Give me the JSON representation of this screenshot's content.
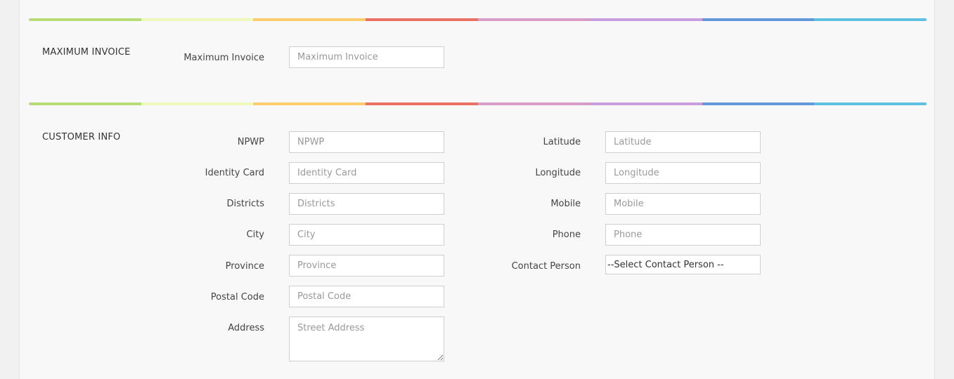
{
  "stripe_colors": [
    "#b5dc77",
    "#eef8b9",
    "#fdcd6d",
    "#ea7264",
    "#d79cc8",
    "#c89ede",
    "#6398dc",
    "#5fc1de"
  ],
  "max_invoice": {
    "title": "MAXIMUM INVOICE",
    "label": "Maximum Invoice",
    "placeholder": "Maximum Invoice",
    "value": ""
  },
  "customer_info": {
    "title": "CUSTOMER INFO",
    "npwp": {
      "label": "NPWP",
      "placeholder": "NPWP"
    },
    "identity_card": {
      "label": "Identity Card",
      "placeholder": "Identity Card"
    },
    "districts": {
      "label": "Districts",
      "placeholder": "Districts"
    },
    "city": {
      "label": "City",
      "placeholder": "City"
    },
    "province": {
      "label": "Province",
      "placeholder": "Province"
    },
    "postal_code": {
      "label": "Postal Code",
      "placeholder": "Postal Code"
    },
    "address": {
      "label": "Address",
      "placeholder": "Street Address"
    },
    "latitude": {
      "label": "Latitude",
      "placeholder": "Latitude"
    },
    "longitude": {
      "label": "Longitude",
      "placeholder": "Longitude"
    },
    "mobile": {
      "label": "Mobile",
      "placeholder": "Mobile"
    },
    "phone": {
      "label": "Phone",
      "placeholder": "Phone"
    },
    "contact_person": {
      "label": "Contact Person",
      "selected": "--Select Contact Person --"
    }
  }
}
